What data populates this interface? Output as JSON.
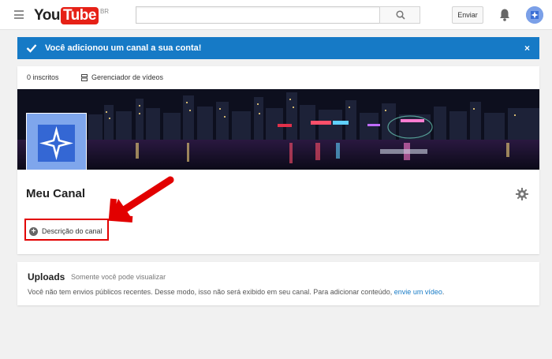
{
  "masthead": {
    "logo_you": "You",
    "logo_tube": "Tube",
    "region": "BR",
    "search_placeholder": "",
    "upload_label": "Enviar"
  },
  "notice": {
    "message": "Você adicionou um canal a sua conta!",
    "close": "×",
    "color": "#167ac6"
  },
  "channel": {
    "subscribers": "0 inscritos",
    "video_manager": "Gerenciador de vídeos",
    "title": "Meu Canal",
    "description_button": "Descrição do canal"
  },
  "uploads": {
    "title": "Uploads",
    "visibility": "Somente você pode visualizar",
    "empty_text": "Você não tem envios públicos recentes. Desse modo, isso não será exibido em seu canal. Para adicionar conteúdo,",
    "link_text": "envie um vídeo",
    "trailing": "."
  },
  "icons": {
    "menu": "hamburger-icon",
    "search": "search-icon",
    "notifications": "bell-icon",
    "settings": "gear-icon",
    "add": "plus-circle-icon",
    "check": "check-icon"
  },
  "colors": {
    "brand_red": "#e62117",
    "annotation_red": "#e20000",
    "link_blue": "#167ac6"
  }
}
